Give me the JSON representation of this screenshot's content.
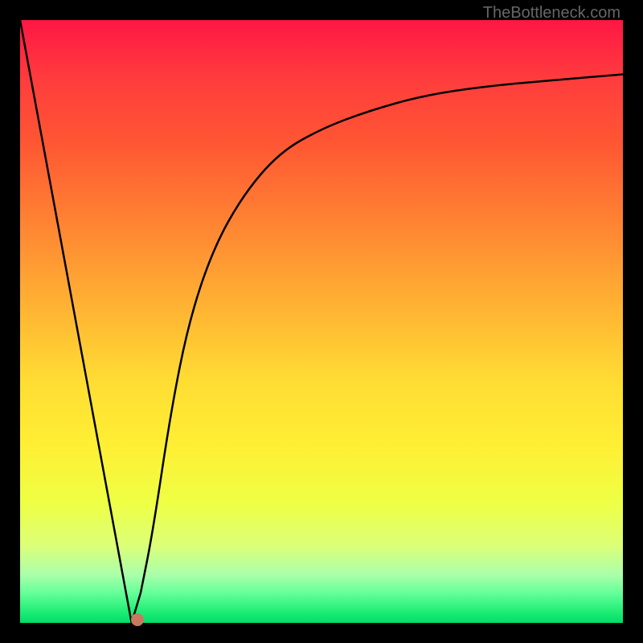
{
  "watermark": "TheBottleneck.com",
  "chart_data": {
    "type": "line",
    "title": "",
    "xlabel": "",
    "ylabel": "",
    "xlim": [
      0,
      1
    ],
    "ylim": [
      0,
      1
    ],
    "series": [
      {
        "name": "curve",
        "x": [
          0.0,
          0.05,
          0.1,
          0.15,
          0.185,
          0.2,
          0.22,
          0.25,
          0.28,
          0.32,
          0.37,
          0.43,
          0.5,
          0.58,
          0.67,
          0.77,
          0.88,
          1.0
        ],
        "y": [
          1.0,
          0.72,
          0.45,
          0.18,
          0.0,
          0.05,
          0.15,
          0.35,
          0.5,
          0.62,
          0.71,
          0.78,
          0.82,
          0.85,
          0.875,
          0.89,
          0.9,
          0.91
        ]
      }
    ],
    "marker": {
      "x": 0.195,
      "y": 0.005
    },
    "background": "rainbow-gradient"
  }
}
